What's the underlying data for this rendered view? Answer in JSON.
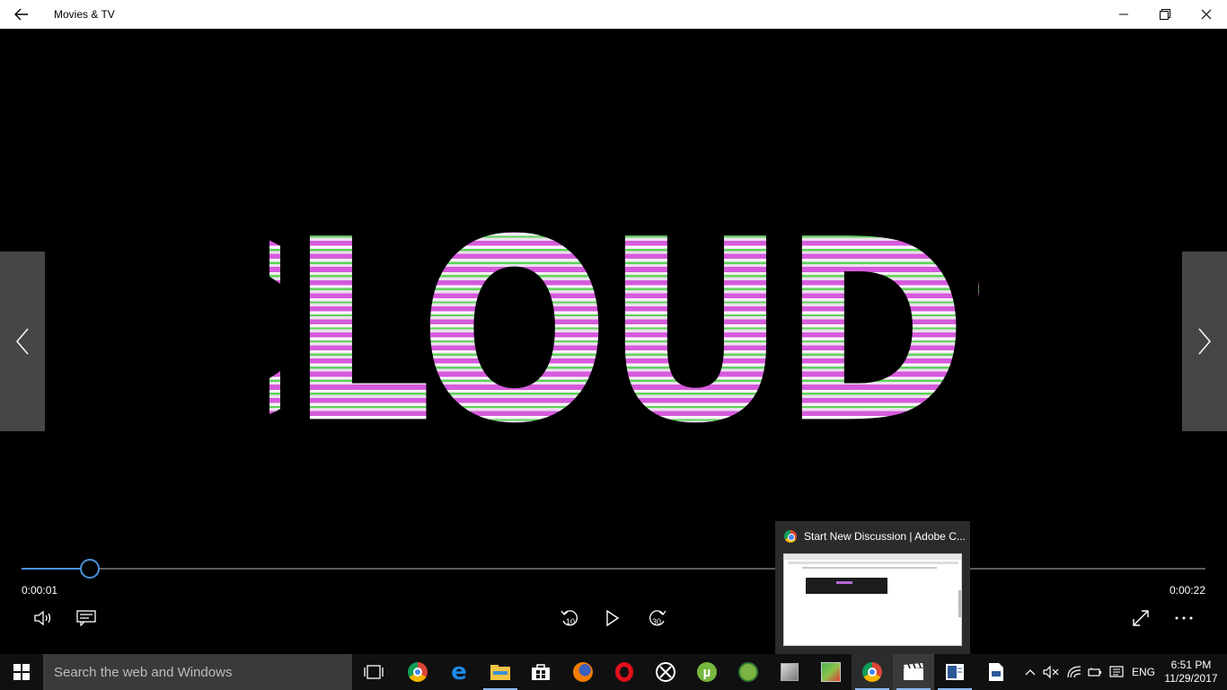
{
  "app": {
    "title": "Movies & TV"
  },
  "video": {
    "overlay_text": "CLOUDS"
  },
  "player": {
    "elapsed": "0:00:01",
    "duration": "0:00:22",
    "progress_fraction": 0.058,
    "accent_color": "#4a90d9",
    "skip_back_seconds": "10",
    "skip_forward_seconds": "30"
  },
  "preview": {
    "title": "Start New Discussion | Adobe C...",
    "icon": "chrome-icon"
  },
  "taskbar": {
    "search_placeholder": "Search the web and Windows",
    "pinned": [
      "task-view-icon",
      "chrome-icon",
      "edge-icon",
      "file-explorer-icon",
      "store-icon",
      "firefox-icon",
      "opera-icon",
      "xbox-icon",
      "utorrent-icon",
      "android-studio-icon",
      "app-icon",
      "game-icon",
      "chrome-icon",
      "movies-tv-icon",
      "word-icon",
      "document-icon"
    ],
    "language": "ENG",
    "time": "6:51 PM",
    "date": "11/29/2017"
  }
}
